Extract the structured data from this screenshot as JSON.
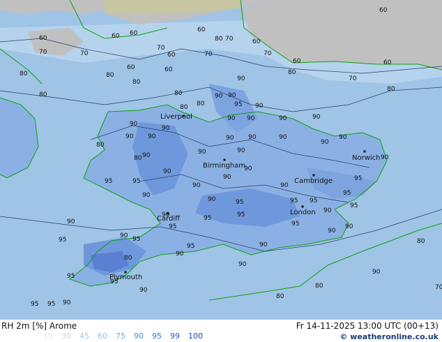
{
  "map": {
    "contour_labels": [
      "60",
      "60",
      "60",
      "60",
      "70",
      "70",
      "60",
      "70",
      "60",
      "80",
      "70",
      "60",
      "70",
      "80",
      "70",
      "60",
      "60",
      "60",
      "60",
      "70",
      "80",
      "80",
      "80",
      "80",
      "80",
      "80",
      "90",
      "90",
      "90",
      "95",
      "90",
      "80",
      "80",
      "90",
      "90",
      "90",
      "90",
      "90",
      "90",
      "90",
      "90",
      "90",
      "90",
      "90",
      "80",
      "90",
      "80",
      "90",
      "90",
      "90",
      "90",
      "90",
      "90",
      "90",
      "90",
      "90",
      "90",
      "95",
      "90",
      "95",
      "95",
      "95",
      "90",
      "95",
      "90",
      "95",
      "95",
      "90",
      "90",
      "95",
      "95",
      "95",
      "95",
      "90",
      "90",
      "90",
      "90",
      "95",
      "95",
      "80",
      "95",
      "95",
      "90",
      "95",
      "90",
      "95",
      "80",
      "90",
      "80",
      "80",
      "70",
      "90",
      "95",
      "95",
      "90"
    ],
    "cities": [
      {
        "name": "Liverpool"
      },
      {
        "name": "Birmingham"
      },
      {
        "name": "Norwich"
      },
      {
        "name": "Cambridge"
      },
      {
        "name": "London"
      },
      {
        "name": "Cardiff"
      },
      {
        "name": "Plymouth"
      }
    ],
    "colors": {
      "sea_lightest": "#c0d8ea",
      "rh_80": "#9fc4e6",
      "rh_90": "#8bb1e4",
      "rh_95": "#6f98dc",
      "rh_99": "#5b7fd2",
      "land_grey": "#c0c0c0",
      "land_khaki": "#c8c6a2",
      "coastline": "#10a010",
      "contour": "#2c3a6a"
    }
  },
  "footer": {
    "title": "RH 2m [%] Arome",
    "datetime": "Fr 14-11-2025 13:00 UTC (00+13)",
    "legend": [
      {
        "value": "15",
        "color": "#d8e4ee"
      },
      {
        "value": "30",
        "color": "#c4d6e8"
      },
      {
        "value": "45",
        "color": "#a8c4e0"
      },
      {
        "value": "60",
        "color": "#8cc4e8"
      },
      {
        "value": "75",
        "color": "#6cb0e0"
      },
      {
        "value": "90",
        "color": "#4a8ad8"
      },
      {
        "value": "95",
        "color": "#3a70d0"
      },
      {
        "value": "99",
        "color": "#2c58c4"
      },
      {
        "value": "100",
        "color": "#1e44b4"
      }
    ],
    "credit_symbol": "©",
    "credit_text": "weatheronline.co.uk"
  }
}
